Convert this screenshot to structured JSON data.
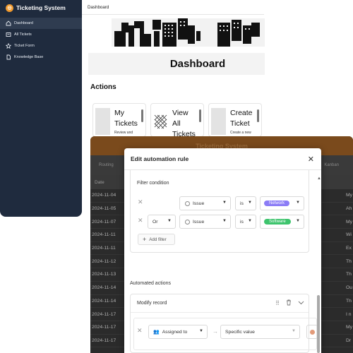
{
  "app": {
    "title": "Ticketing System",
    "logo_letter": "ts"
  },
  "sidebar": {
    "items": [
      {
        "label": "Dashboard",
        "icon": "home-icon",
        "active": true
      },
      {
        "label": "All Tickets",
        "icon": "tickets-icon",
        "active": false
      },
      {
        "label": "Ticket Form",
        "icon": "star-icon",
        "active": false
      },
      {
        "label": "Knowledge Base",
        "icon": "document-icon",
        "active": false
      }
    ]
  },
  "topbar": {
    "title": "Dashboard"
  },
  "page": {
    "header": "Dashboard",
    "section": "Actions"
  },
  "cards": [
    {
      "title_1": "My",
      "title_2": "Tickets",
      "subtitle": "Review and"
    },
    {
      "title_1": "View",
      "title_2": "All",
      "title_3": "Tickets",
      "subtitle": ""
    },
    {
      "title_1": "Create",
      "title_2": "Ticket",
      "subtitle": "Create a new"
    }
  ],
  "background_table": {
    "window_title": "Ticketing System",
    "toolbar_left": "Routing",
    "toolbar_right": "Kanban",
    "date_header": "Date",
    "dates": [
      "2024-11-04",
      "2024-11-05",
      "2024-11-07",
      "2024-11-11",
      "2024-11-11",
      "2024-11-12",
      "2024-11-13",
      "2024-11-14",
      "2024-11-14",
      "2024-11-17",
      "2024-11-17",
      "2024-11-17"
    ],
    "right_snippets": [
      "My",
      "Ah",
      "My",
      "Wi",
      "Ex",
      "Th",
      "Th",
      "Ou",
      "Th",
      "I n",
      "My",
      "Dr"
    ]
  },
  "modal": {
    "title": "Edit automation rule",
    "filter_label": "Filter condition",
    "filters": [
      {
        "conjunction": "",
        "field": "Issue",
        "operator": "is",
        "value": "Network",
        "value_color": "#8b7cf6"
      },
      {
        "conjunction": "Or",
        "field": "Issue",
        "operator": "is",
        "value": "Software",
        "value_color": "#3ec46d"
      }
    ],
    "add_filter_label": "Add filter",
    "automated_actions_label": "Automated actions",
    "record_action_title": "Modify record",
    "assignment": {
      "field": "Assigned to",
      "mode": "Specific value"
    }
  },
  "colors": {
    "sidebar_bg": "#1f2b3e",
    "accent": "#f29b2e"
  }
}
